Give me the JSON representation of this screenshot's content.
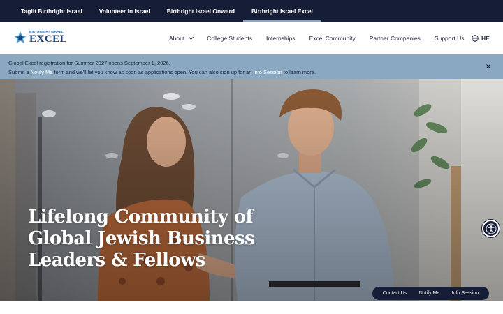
{
  "topbar": {
    "items": [
      {
        "label": "Taglit Birthright Israel"
      },
      {
        "label": "Volunteer In Israel"
      },
      {
        "label": "Birthright Israel Onward"
      },
      {
        "label": "Birthright Israel Excel"
      }
    ],
    "active_index": 3
  },
  "header": {
    "logo": {
      "small_text": "BIRTHRIGHT ISRAEL",
      "big_text": "EXCEL"
    },
    "nav": [
      {
        "label": "About",
        "has_dropdown": true
      },
      {
        "label": "College Students"
      },
      {
        "label": "Internships"
      },
      {
        "label": "Excel Community"
      },
      {
        "label": "Partner Companies"
      },
      {
        "label": "Support Us"
      }
    ],
    "language": "HE"
  },
  "announcement": {
    "line1": "Global Excel registration for Summer 2027 opens September 1, 2026.",
    "line2_pre": "Submit a ",
    "link1": "Notify Me",
    "line2_mid": " form and we'll let you know as soon as applications open. You can also sign up for an ",
    "link2": "Info Session",
    "line2_post": " to learn more."
  },
  "hero": {
    "title_lines": [
      "Lifelong Community of",
      "Global Jewish Business",
      "Leaders & Fellows"
    ]
  },
  "cta": {
    "buttons": [
      {
        "label": "Contact Us"
      },
      {
        "label": "Notify Me"
      },
      {
        "label": "Info Session"
      }
    ]
  },
  "icons": {
    "globe": "globe-icon",
    "close": "close-icon",
    "accessibility": "accessibility-icon",
    "chevron": "chevron-down-icon"
  },
  "colors": {
    "navy": "#161d36",
    "banner": "#8aa8c0",
    "active_underline": "#8da6bd",
    "logo_blue": "#1b3f7a"
  }
}
